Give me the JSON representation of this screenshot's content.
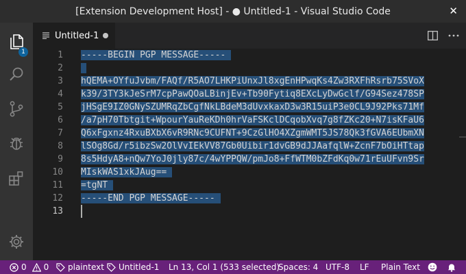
{
  "window": {
    "title": "[Extension Development Host] - ● Untitled-1 - Visual Studio Code"
  },
  "activity_bar": {
    "explorer_badge": "1"
  },
  "tabs": [
    {
      "label": "Untitled-1"
    }
  ],
  "editor": {
    "line_numbers": [
      "1",
      "2",
      "3",
      "4",
      "5",
      "6",
      "7",
      "8",
      "9",
      "10",
      "11",
      "12",
      "13"
    ],
    "lines": [
      "-----BEGIN PGP MESSAGE-----",
      "",
      "hQEMA+OYfuJvbm/FAQf/R5AO7LHKPiUnxJl8xgEnHPwqKs4Zw3RXFhRsrb75SVoX",
      "k39/3TY3kJeSrM7cpPawQOaLBinjEv+Tb90Fytiq8EXcLyDwGclf/G94Sez478SP",
      "jHSgE9IZ0GNySZUMRqZbCgfNkLBdeM3dUvxkaxD3w3R15uiP3e0CL9J92Pks71Mf",
      "/a7pH70Tbtgit+WpourYauReKDh0hrVaFSKclDCqobXvq7g8fZKc20+N7isKFaU6",
      "Q6xFgxnz4RxuBXbX6vR9RNc9CUFNT+9CzGlHO4XZgmWMT5JS78Qk3fGVA6EUbmXN",
      "lSOg8Gd/r5ibzSw2OlVvIEkVV87Gb0Uibir1dvGB9dJJAafqlW+ZcnF7bOiHTtap",
      "8s5HdyA8+nQw7YoJ0jly87c/4wYPPQW/pmJo8+FfWTM0bZFdKq0w71rEuUFvn9Sr",
      "MIskWAS1xkJAug==",
      "=tgNT",
      "-----END PGP MESSAGE-----",
      ""
    ]
  },
  "status_bar": {
    "errors": "0",
    "warnings": "0",
    "language_mode_item": "plaintext",
    "file_item": "Untitled-1",
    "cursor_position": "Ln 13, Col 1 (533 selected)",
    "indentation": "Spaces: 4",
    "encoding": "UTF-8",
    "eol": "LF",
    "language": "Plain Text"
  },
  "colors": {
    "status_bar_bg": "#68217a",
    "selection": "#264f78",
    "activity_bar_bg": "#333333",
    "editor_bg": "#1e1e1e",
    "badge_bg": "#0e639c"
  }
}
